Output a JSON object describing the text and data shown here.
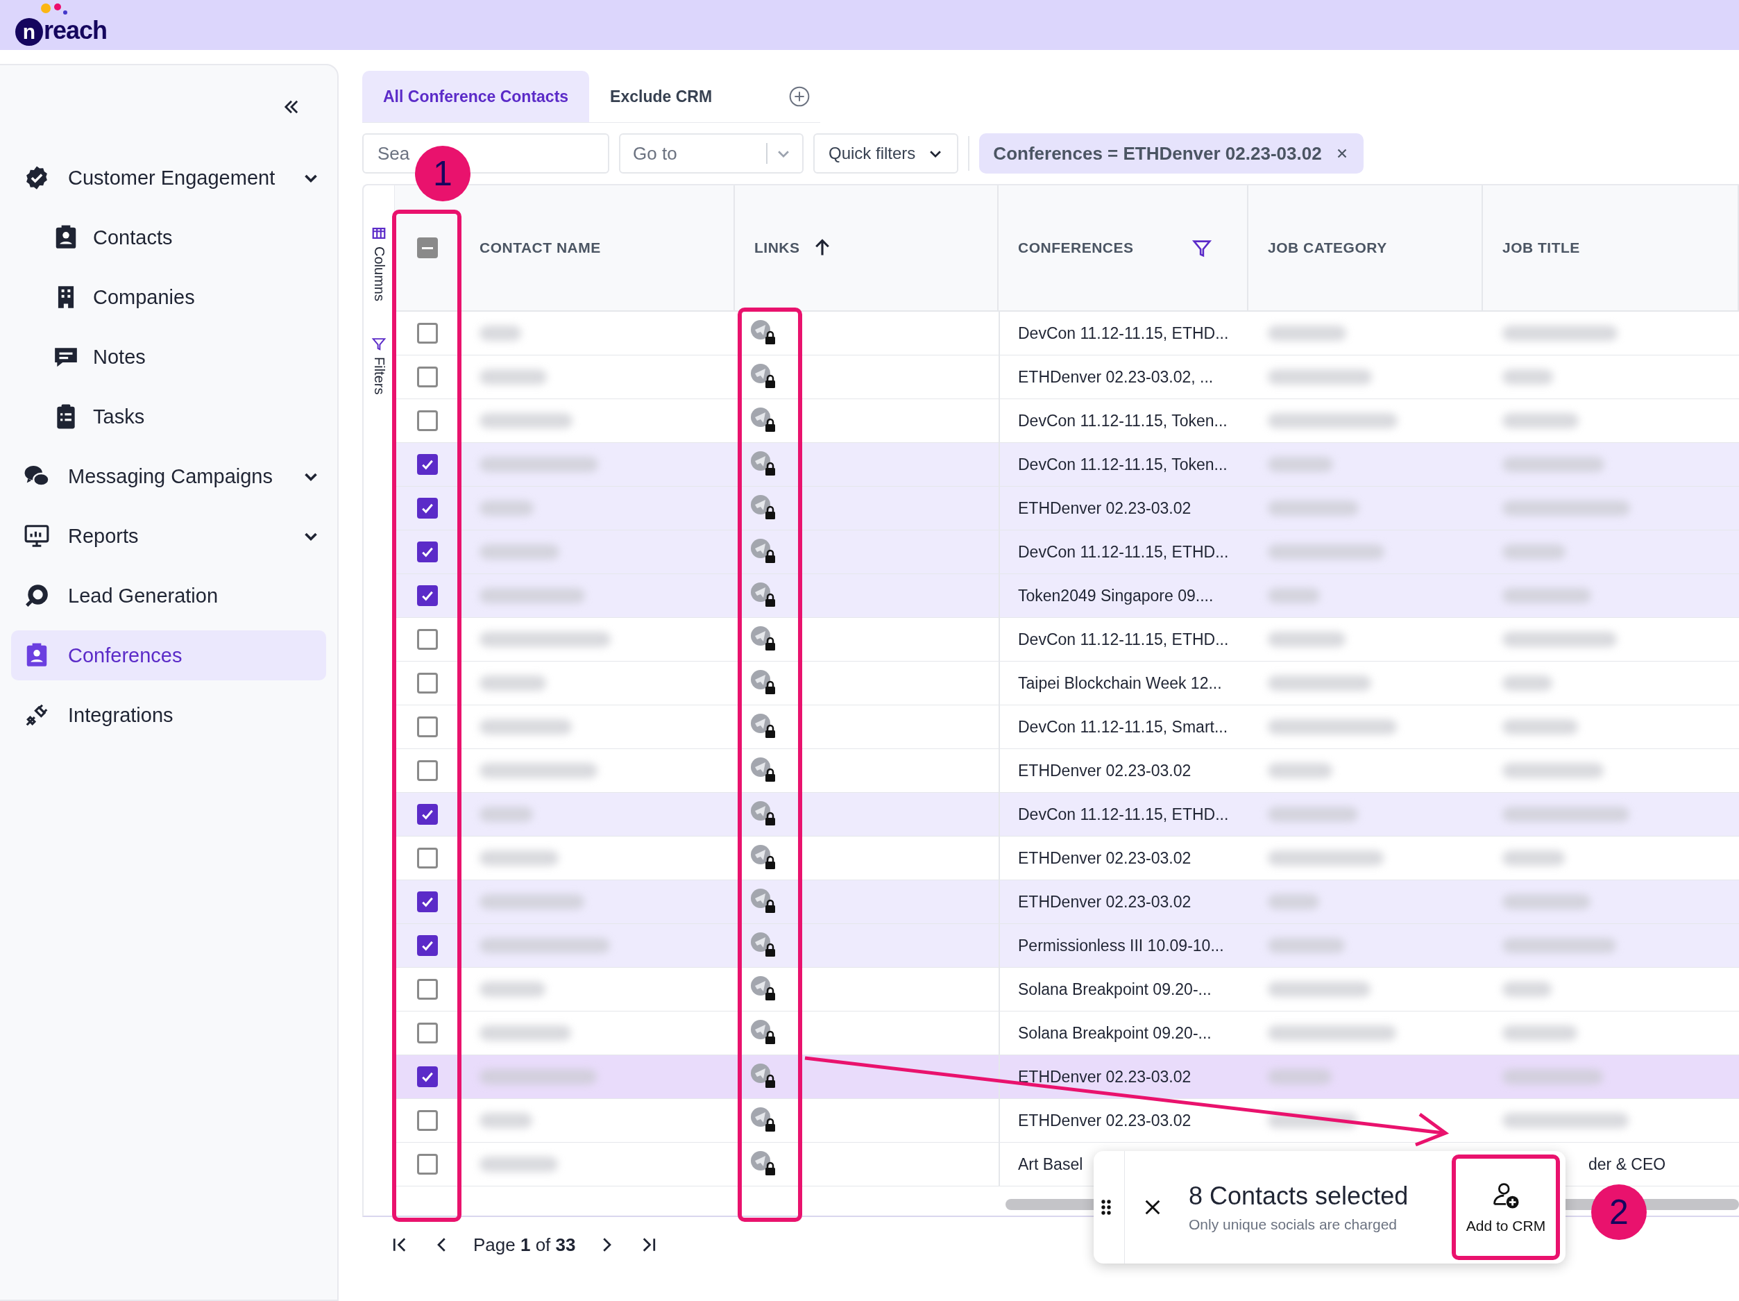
{
  "app": {
    "logo": "reach",
    "logo_mark": "n"
  },
  "sidebar": {
    "items": [
      {
        "label": "Customer Engagement",
        "kind": "group",
        "selected": false,
        "children": [
          {
            "label": "Contacts",
            "selected": false
          },
          {
            "label": "Companies",
            "selected": false
          },
          {
            "label": "Notes",
            "selected": false
          },
          {
            "label": "Tasks",
            "selected": false
          }
        ]
      },
      {
        "label": "Messaging Campaigns",
        "kind": "group",
        "selected": false
      },
      {
        "label": "Reports",
        "kind": "group",
        "selected": false
      },
      {
        "label": "Lead Generation",
        "kind": "link",
        "selected": false
      },
      {
        "label": "Conferences",
        "kind": "link",
        "selected": true
      },
      {
        "label": "Integrations",
        "kind": "link",
        "selected": false
      }
    ]
  },
  "tabs": [
    {
      "label": "All Conference Contacts",
      "selected": true
    },
    {
      "label": "Exclude CRM",
      "selected": false
    }
  ],
  "toolbar": {
    "search": {
      "placeholder": "Sea"
    },
    "goto": {
      "placeholder": "Go to"
    },
    "quick_filters": "Quick filters",
    "filter_chip": "Conferences = ETHDenver 02.23-03.02"
  },
  "side_tools": [
    "Columns",
    "Filters"
  ],
  "table": {
    "columns": [
      "CONTACT NAME",
      "LINKS",
      "CONFERENCES",
      "JOB CATEGORY",
      "JOB TITLE"
    ],
    "select_all_indeterminate": true,
    "rows": [
      {
        "conferences": "DevCon 11.12-11.15, ETHD...",
        "checked": false,
        "hovered": false
      },
      {
        "conferences": "ETHDenver 02.23-03.02, ...",
        "checked": false,
        "hovered": false
      },
      {
        "conferences": "DevCon 11.12-11.15, Token...",
        "checked": false,
        "hovered": false
      },
      {
        "conferences": "DevCon 11.12-11.15, Token...",
        "checked": true,
        "hovered": false
      },
      {
        "conferences": "ETHDenver 02.23-03.02",
        "checked": true,
        "hovered": false
      },
      {
        "conferences": "DevCon 11.12-11.15, ETHD...",
        "checked": true,
        "hovered": false
      },
      {
        "conferences": "Token2049 Singapore 09....",
        "checked": true,
        "hovered": false
      },
      {
        "conferences": "DevCon 11.12-11.15, ETHD...",
        "checked": false,
        "hovered": false
      },
      {
        "conferences": "Taipei Blockchain Week 12...",
        "checked": false,
        "hovered": false
      },
      {
        "conferences": "DevCon 11.12-11.15, Smart...",
        "checked": false,
        "hovered": false
      },
      {
        "conferences": "ETHDenver 02.23-03.02",
        "checked": false,
        "hovered": false
      },
      {
        "conferences": "DevCon 11.12-11.15, ETHD...",
        "checked": true,
        "hovered": false
      },
      {
        "conferences": "ETHDenver 02.23-03.02",
        "checked": false,
        "hovered": false
      },
      {
        "conferences": "ETHDenver 02.23-03.02",
        "checked": true,
        "hovered": false
      },
      {
        "conferences": "Permissionless III 10.09-10...",
        "checked": true,
        "hovered": false
      },
      {
        "conferences": "Solana Breakpoint 09.20-...",
        "checked": false,
        "hovered": false
      },
      {
        "conferences": "Solana Breakpoint 09.20-...",
        "checked": false,
        "hovered": false
      },
      {
        "conferences": "ETHDenver 02.23-03.02",
        "checked": true,
        "hovered": true
      },
      {
        "conferences": "ETHDenver 02.23-03.02",
        "checked": false,
        "hovered": false
      },
      {
        "conferences": "Art Basel",
        "checked": false,
        "hovered": false,
        "job_title": "der & CEO"
      }
    ]
  },
  "pagination": {
    "label": "Page **1** of **33**"
  },
  "selection_bar": {
    "title": "8 Contacts selected",
    "subtitle": "Only unique socials are charged",
    "action": "Add to CRM"
  },
  "annotations": [
    {
      "label": "1"
    },
    {
      "label": "2"
    }
  ]
}
